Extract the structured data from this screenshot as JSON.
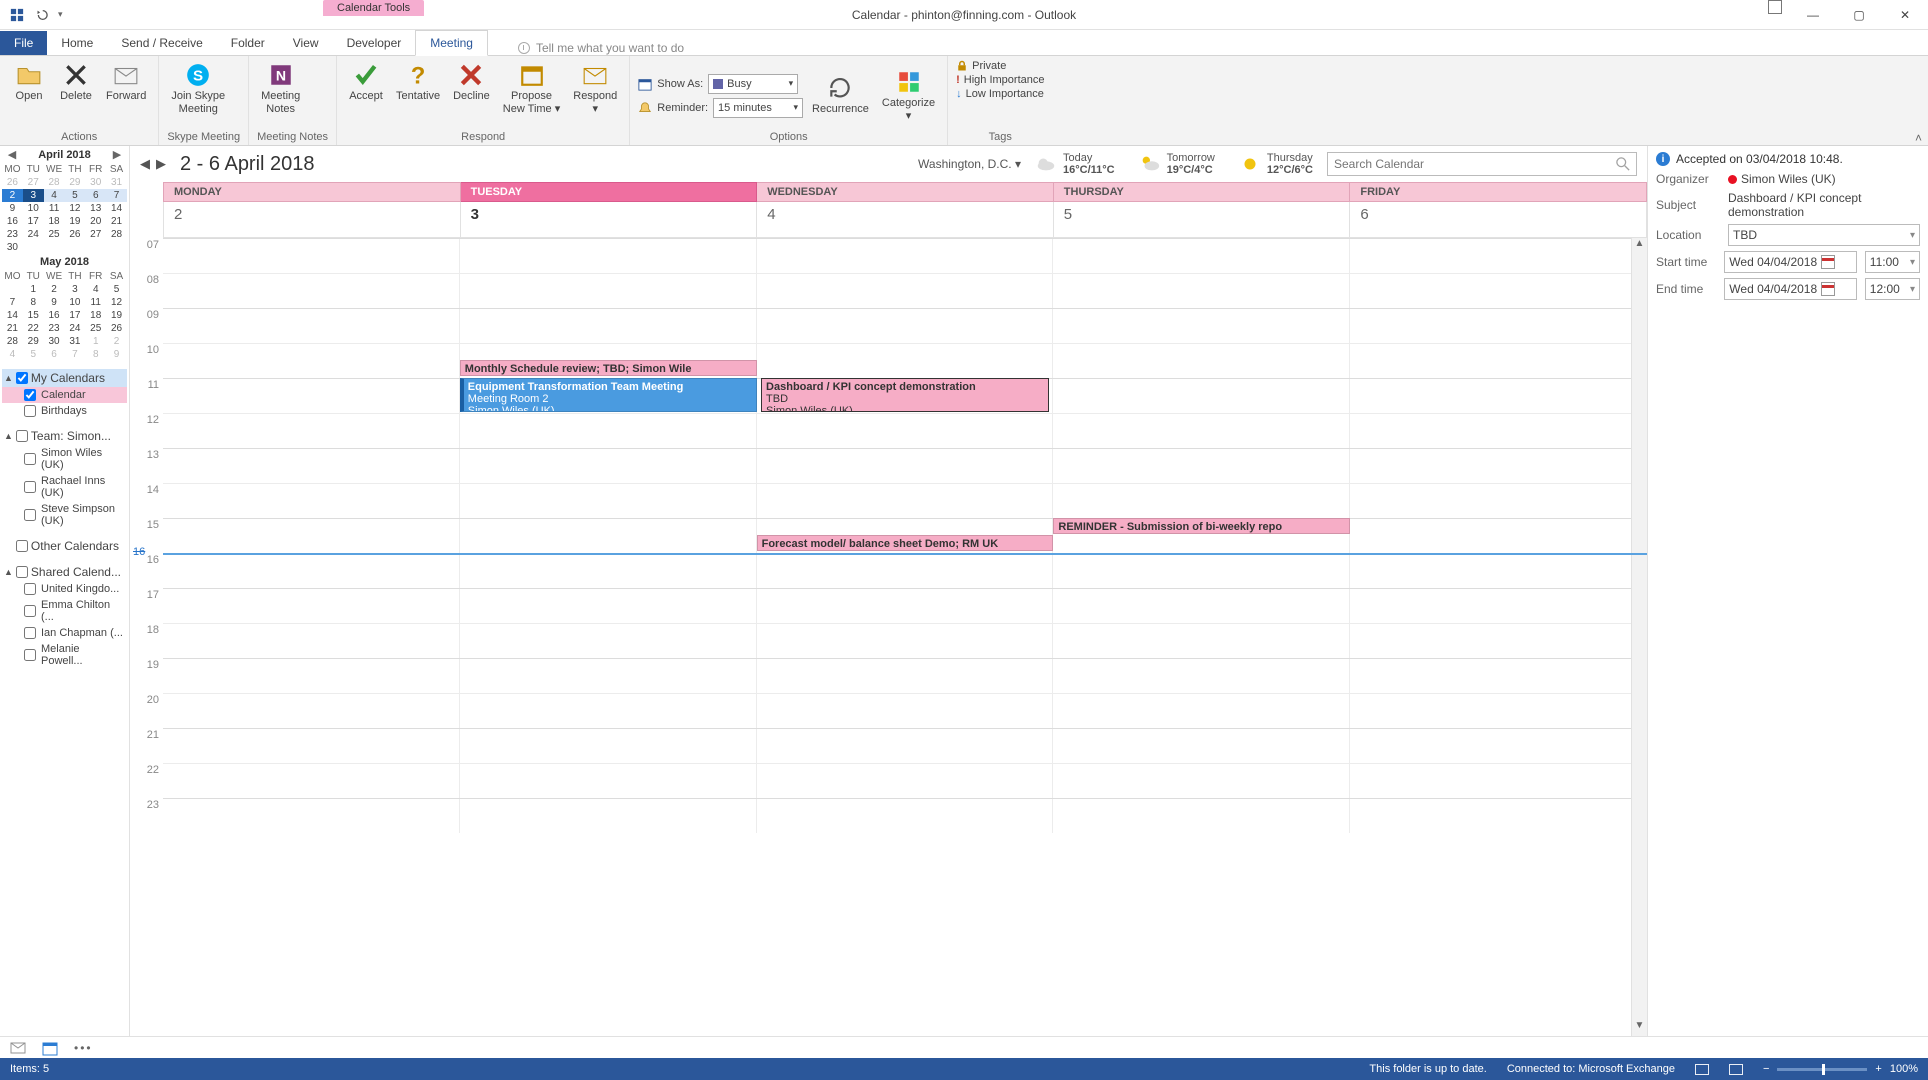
{
  "titlebar": {
    "context_tab": "Calendar Tools",
    "title": "Calendar - phinton@finning.com  -  Outlook"
  },
  "tabs": {
    "file": "File",
    "items": [
      "Home",
      "Send / Receive",
      "Folder",
      "View",
      "Developer",
      "Meeting"
    ],
    "active": "Meeting",
    "tellme": "Tell me what you want to do"
  },
  "ribbon": {
    "actions": {
      "label": "Actions",
      "open": "Open",
      "delete": "Delete",
      "forward": "Forward"
    },
    "skype": {
      "label": "Skype Meeting",
      "btn": "Join Skype\nMeeting"
    },
    "notes": {
      "label": "Meeting Notes",
      "btn": "Meeting\nNotes"
    },
    "respond": {
      "label": "Respond",
      "accept": "Accept",
      "tentative": "Tentative",
      "decline": "Decline",
      "propose": "Propose\nNew Time ▾",
      "respond": "Respond\n▾"
    },
    "options": {
      "label": "Options",
      "showas_lbl": "Show As:",
      "showas_val": "Busy",
      "reminder_lbl": "Reminder:",
      "reminder_val": "15 minutes",
      "recurrence": "Recurrence",
      "categorize": "Categorize\n▾"
    },
    "tags": {
      "label": "Tags",
      "private": "Private",
      "high": "High Importance",
      "low": "Low Importance"
    }
  },
  "mini": {
    "dow": [
      "MO",
      "TU",
      "WE",
      "TH",
      "FR",
      "SA"
    ],
    "april": {
      "title": "April 2018",
      "rows": [
        [
          "26",
          "27",
          "28",
          "29",
          "30",
          "31"
        ],
        [
          "2",
          "3",
          "4",
          "5",
          "6",
          "7"
        ],
        [
          "9",
          "10",
          "11",
          "12",
          "13",
          "14"
        ],
        [
          "16",
          "17",
          "18",
          "19",
          "20",
          "21"
        ],
        [
          "23",
          "24",
          "25",
          "26",
          "27",
          "28"
        ],
        [
          "30",
          "",
          "",
          "",
          "",
          ""
        ]
      ]
    },
    "may": {
      "title": "May 2018",
      "rows": [
        [
          "",
          "1",
          "2",
          "3",
          "4",
          "5"
        ],
        [
          "7",
          "8",
          "9",
          "10",
          "11",
          "12"
        ],
        [
          "14",
          "15",
          "16",
          "17",
          "18",
          "19"
        ],
        [
          "21",
          "22",
          "23",
          "24",
          "25",
          "26"
        ],
        [
          "28",
          "29",
          "30",
          "31",
          "1",
          "2"
        ],
        [
          "4",
          "5",
          "6",
          "7",
          "8",
          "9"
        ]
      ]
    }
  },
  "calendars": {
    "my": {
      "hdr": "My Calendars",
      "items": [
        "Calendar",
        "Birthdays"
      ]
    },
    "team": {
      "hdr": "Team: Simon...",
      "items": [
        "Simon Wiles (UK)",
        "Rachael Inns (UK)",
        "Steve Simpson (UK)"
      ]
    },
    "other": {
      "hdr": "Other Calendars"
    },
    "shared": {
      "hdr": "Shared Calend...",
      "items": [
        "United Kingdo...",
        "Emma Chilton (...",
        "Ian Chapman (...",
        "Melanie Powell..."
      ]
    }
  },
  "calhdr": {
    "range": "2 - 6 April 2018",
    "loc": "Washington, D.C.  ▾",
    "w": [
      {
        "d": "Today",
        "t": "16°C/11°C"
      },
      {
        "d": "Tomorrow",
        "t": "19°C/4°C"
      },
      {
        "d": "Thursday",
        "t": "12°C/6°C"
      }
    ],
    "search_ph": "Search Calendar"
  },
  "days": [
    "MONDAY",
    "TUESDAY",
    "WEDNESDAY",
    "THURSDAY",
    "FRIDAY"
  ],
  "dates": [
    "2",
    "3",
    "4",
    "5",
    "6"
  ],
  "hours": [
    "07",
    "08",
    "09",
    "10",
    "11",
    "12",
    "13",
    "14",
    "15",
    "16",
    "17",
    "18",
    "19",
    "20",
    "21",
    "22",
    "23"
  ],
  "now": "16",
  "events": {
    "e1": {
      "title": "Monthly Schedule review; ",
      "rest": "TBD; Simon Wile"
    },
    "e2": {
      "title": "Equipment Transformation Team Meeting",
      "loc": "Meeting Room 2",
      "org": "Simon Wiles (UK)"
    },
    "e3": {
      "title": "Dashboard / KPI concept demonstration",
      "loc": "TBD",
      "org": "Simon Wiles (UK)"
    },
    "e4": {
      "title": "Forecast model/ balance sheet Demo; ",
      "rest": "RM UK"
    },
    "e5": {
      "title": "REMINDER - Submission of bi-weekly repo"
    }
  },
  "detail": {
    "accepted": "Accepted on 03/04/2018 10:48.",
    "organizer_lbl": "Organizer",
    "organizer": "Simon Wiles (UK)",
    "subject_lbl": "Subject",
    "subject": "Dashboard / KPI concept demonstration",
    "location_lbl": "Location",
    "location": "TBD",
    "start_lbl": "Start time",
    "start_date": "Wed 04/04/2018",
    "start_time": "11:00",
    "end_lbl": "End time",
    "end_date": "Wed 04/04/2018",
    "end_time": "12:00"
  },
  "status": {
    "items": "Items: 5",
    "folder": "This folder is up to date.",
    "conn": "Connected to: Microsoft Exchange",
    "zoom": "100%"
  }
}
